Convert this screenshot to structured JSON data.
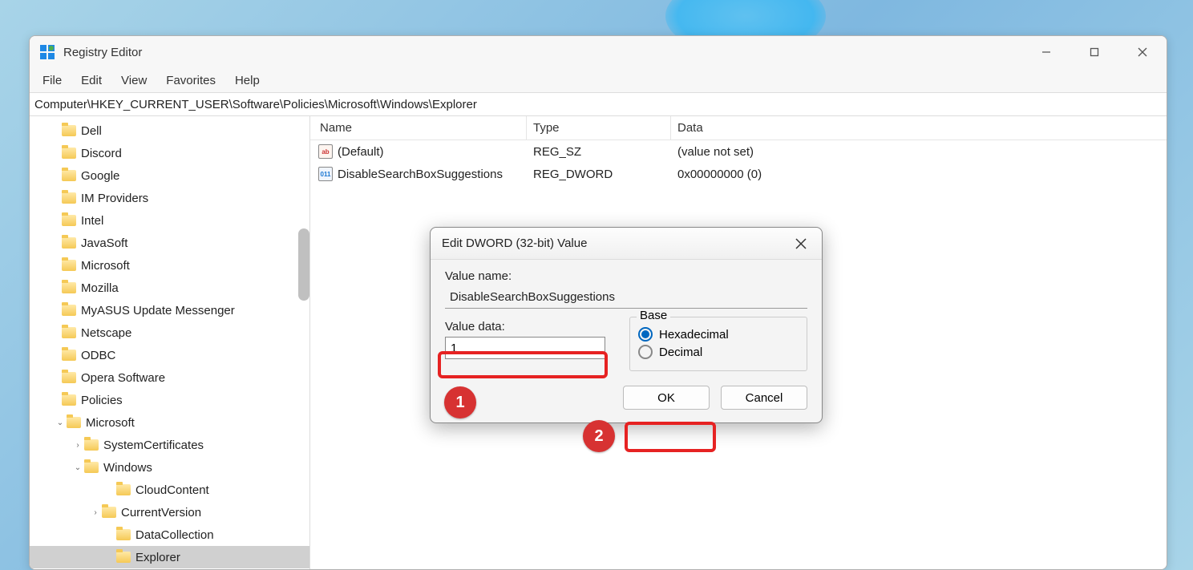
{
  "window": {
    "title": "Registry Editor"
  },
  "menu": {
    "file": "File",
    "edit": "Edit",
    "view": "View",
    "favorites": "Favorites",
    "help": "Help"
  },
  "addressbar": "Computer\\HKEY_CURRENT_USER\\Software\\Policies\\Microsoft\\Windows\\Explorer",
  "tree": [
    {
      "indent": 40,
      "chevron": "",
      "label": "Dell"
    },
    {
      "indent": 40,
      "chevron": "",
      "label": "Discord"
    },
    {
      "indent": 40,
      "chevron": "",
      "label": "Google"
    },
    {
      "indent": 40,
      "chevron": "",
      "label": "IM Providers"
    },
    {
      "indent": 40,
      "chevron": "",
      "label": "Intel"
    },
    {
      "indent": 40,
      "chevron": "",
      "label": "JavaSoft"
    },
    {
      "indent": 40,
      "chevron": "",
      "label": "Microsoft"
    },
    {
      "indent": 40,
      "chevron": "",
      "label": "Mozilla"
    },
    {
      "indent": 40,
      "chevron": "",
      "label": "MyASUS Update Messenger"
    },
    {
      "indent": 40,
      "chevron": "",
      "label": "Netscape"
    },
    {
      "indent": 40,
      "chevron": "",
      "label": "ODBC"
    },
    {
      "indent": 40,
      "chevron": "",
      "label": "Opera Software"
    },
    {
      "indent": 40,
      "chevron": "",
      "label": "Policies"
    },
    {
      "indent": 46,
      "chevron": "⌄",
      "label": "Microsoft"
    },
    {
      "indent": 68,
      "chevron": "›",
      "label": "SystemCertificates"
    },
    {
      "indent": 68,
      "chevron": "⌄",
      "label": "Windows"
    },
    {
      "indent": 108,
      "chevron": "",
      "label": "CloudContent"
    },
    {
      "indent": 90,
      "chevron": "›",
      "label": "CurrentVersion"
    },
    {
      "indent": 108,
      "chevron": "",
      "label": "DataCollection"
    },
    {
      "indent": 108,
      "chevron": "",
      "label": "Explorer",
      "selected": true
    }
  ],
  "columns": {
    "name": "Name",
    "type": "Type",
    "data": "Data"
  },
  "rows": [
    {
      "icon": "sz",
      "name": "(Default)",
      "type": "REG_SZ",
      "data": "(value not set)"
    },
    {
      "icon": "dw",
      "name": "DisableSearchBoxSuggestions",
      "type": "REG_DWORD",
      "data": "0x00000000 (0)"
    }
  ],
  "dialog": {
    "title": "Edit DWORD (32-bit) Value",
    "value_name_label": "Value name:",
    "value_name": "DisableSearchBoxSuggestions",
    "value_data_label": "Value data:",
    "value_data": "1",
    "base_label": "Base",
    "hex_label": "Hexadecimal",
    "dec_label": "Decimal",
    "ok": "OK",
    "cancel": "Cancel"
  },
  "annotations": {
    "one": "1",
    "two": "2"
  }
}
